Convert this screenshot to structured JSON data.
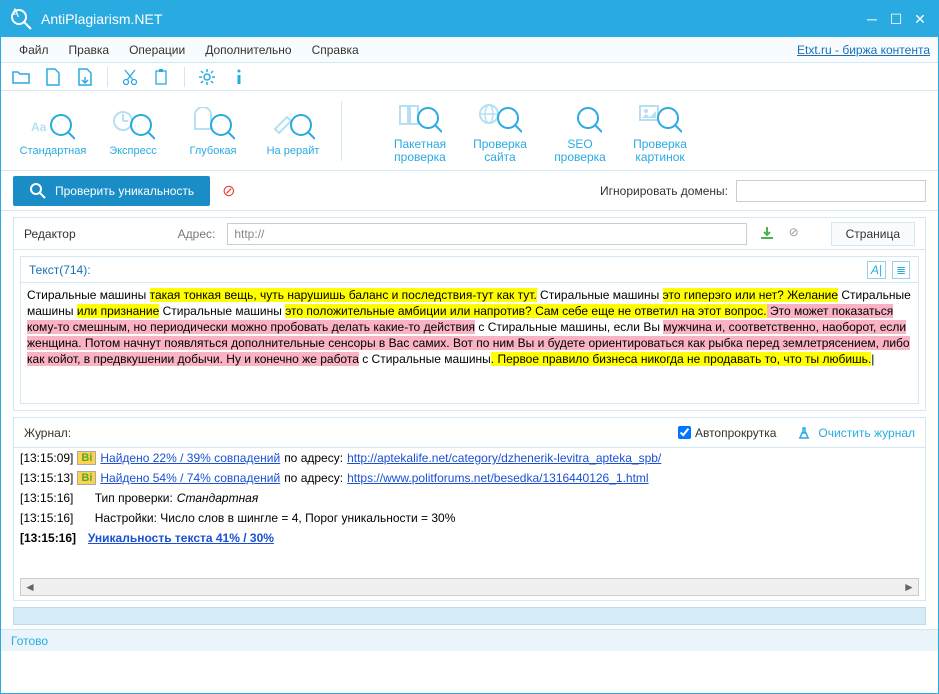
{
  "title": "AntiPlagiarism.NET",
  "menu": {
    "file": "Файл",
    "edit": "Правка",
    "ops": "Операции",
    "extra": "Дополнительно",
    "help": "Справка"
  },
  "rightlink": "Etxt.ru - биржа контента",
  "ribbon": {
    "std": "Стандартная",
    "express": "Экспресс",
    "deep": "Глубокая",
    "rewrite": "На рерайт",
    "batch1": "Пакетная",
    "batch2": "проверка",
    "site1": "Проверка",
    "site2": "сайта",
    "seo1": "SEO",
    "seo2": "проверка",
    "img1": "Проверка",
    "img2": "картинок"
  },
  "action": {
    "check": "Проверить уникальность",
    "ignore": "Игнорировать домены:"
  },
  "editor": {
    "label": "Редактор",
    "addr": "Адрес:",
    "addrval": "http://",
    "tab": "Страница"
  },
  "text": {
    "header": "Текст(714):",
    "t1": "Стиральные машины ",
    "y1": "такая тонкая вещь, чуть нарушишь баланс и последствия-тут как тут.",
    "t2": " Стиральные машины ",
    "y2": "это гиперэго или нет? Желание",
    "t3": " Стиральные машины ",
    "y3": "или признание",
    "t4": " Стиральные машины ",
    "y4": "это положительные амбиции или напротив? Сам себе еще не ответил на этот вопрос.",
    "p1": " Это может показаться кому-то смешным, но периодически можно пробовать делать какие-то действия",
    "t5": " с Стиральные машины, если Вы ",
    "p2": "мужчина и, соответственно, наоборот, если женщина. Потом начнут появляться дополнительные сенсоры в Вас самих. Вот по ним Вы и будете ориентироваться как рыбка перед землетрясением, либо как койот, в предвкушении добычи. Ну и конечно же работа",
    "t6": " с Стиральные машины",
    "y5": ". Первое правило бизнеса никогда не продавать то, что ты любишь.",
    "cursor": "|"
  },
  "journal": {
    "label": "Журнал:",
    "auto": "Автопрокрутка",
    "clear": "Очистить журнал",
    "rows": [
      {
        "time": "[13:15:09]",
        "bi": "Bi",
        "link": "Найдено 22% / 39% совпадений",
        "mid": " по адресу: ",
        "url": "http://aptekalife.net/category/dzhenerik-levitra_apteka_spb/"
      },
      {
        "time": "[13:15:13]",
        "bi": "Bi",
        "link": "Найдено 54% / 74% совпадений",
        "mid": " по адресу: ",
        "url": "https://www.politforums.net/besedka/1316440126_1.html"
      }
    ],
    "type": {
      "time": "[13:15:16]",
      "label": "Тип проверки: ",
      "val": "Стандартная"
    },
    "settings": {
      "time": "[13:15:16]",
      "val": "Настройки: Число слов в шингле = 4, Порог уникальности = 30%"
    },
    "result": {
      "time": "[13:15:16]",
      "val": "Уникальность текста 41% / 30%"
    }
  },
  "status": "Готово"
}
